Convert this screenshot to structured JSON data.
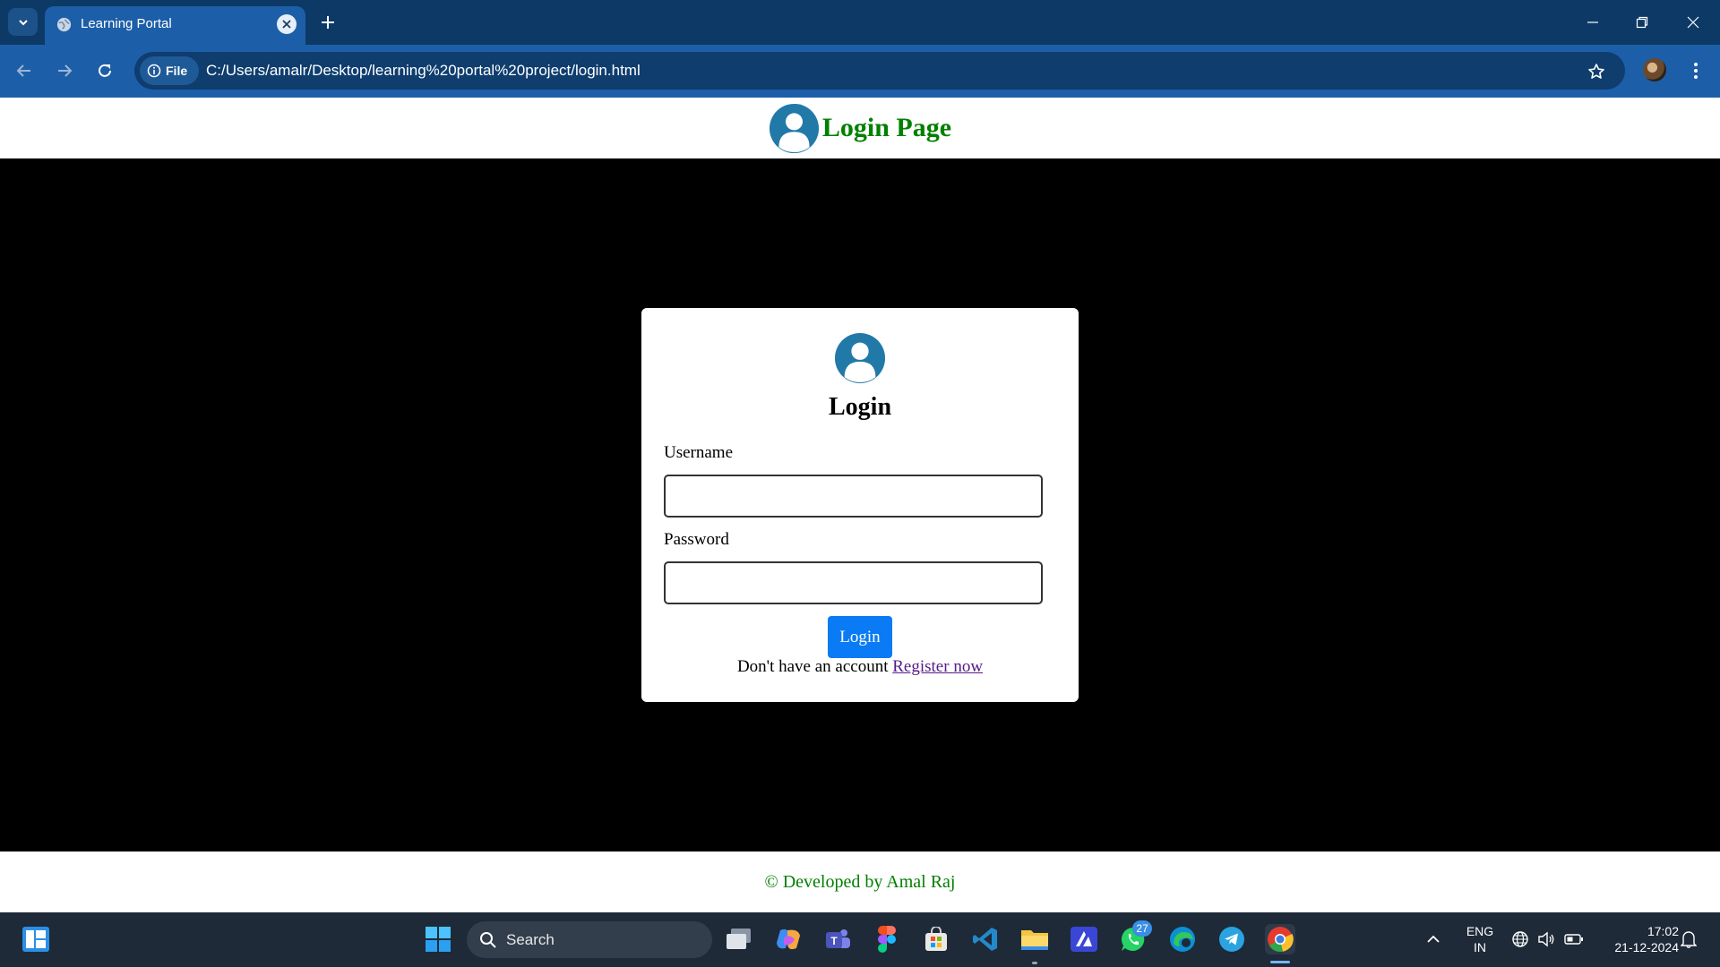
{
  "browser": {
    "tab": {
      "title": "Learning Portal",
      "favicon": "globe-icon"
    },
    "address": {
      "chip_label": "File",
      "url": "C:/Users/amalr/Desktop/learning%20portal%20project/login.html"
    }
  },
  "header": {
    "title": "Login Page"
  },
  "login": {
    "heading": "Login",
    "username_label": "Username",
    "username_value": "",
    "password_label": "Password",
    "password_value": "",
    "button_label": "Login",
    "register_prompt": "Don't have an account",
    "register_link": "Register now"
  },
  "footer": {
    "text": "© Developed by Amal Raj"
  },
  "taskbar": {
    "search_label": "Search",
    "whatsapp_badge": "27",
    "language": "ENG",
    "region": "IN",
    "time": "17:02",
    "date": "21-12-2024",
    "apps": [
      "widgets",
      "start",
      "search",
      "task-view",
      "copilot",
      "teams",
      "figma",
      "store",
      "vscode",
      "file-explorer",
      "affinity",
      "whatsapp",
      "edge",
      "telegram",
      "chrome"
    ]
  },
  "colors": {
    "accent_green": "#008000",
    "button_blue": "#0a7bf5",
    "avatar_blue": "#2179a8",
    "chrome_blue": "#1d5ea8",
    "link_purple": "#551a8b"
  }
}
